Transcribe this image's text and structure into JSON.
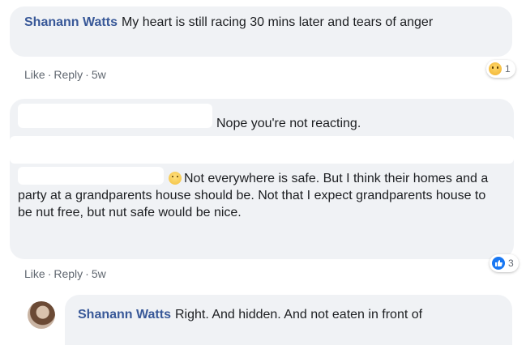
{
  "comments": [
    {
      "author": "Shanann Watts",
      "text": "My heart is still racing 30 mins later and tears of anger",
      "actions": {
        "like": "Like",
        "reply": "Reply",
        "age": "5w",
        "sep": "·"
      },
      "reaction": {
        "icon": "sad-emoji-icon",
        "count": "1"
      }
    },
    {
      "line1": "Nope you're not reacting.",
      "line2": "Not everywhere is safe. But I think their homes and a party at a grandparents house should be. Not that I expect grandparents house to be nut free, but nut safe would be nice.",
      "actions": {
        "like": "Like",
        "reply": "Reply",
        "age": "5w",
        "sep": "·"
      },
      "reaction": {
        "icon": "like-icon",
        "count": "3"
      }
    },
    {
      "author": "Shanann Watts",
      "text": "Right. And hidden. And not eaten in front of"
    }
  ],
  "colors": {
    "bubble": "#f0f2f5",
    "name": "#385898",
    "like": "#1877f2"
  }
}
